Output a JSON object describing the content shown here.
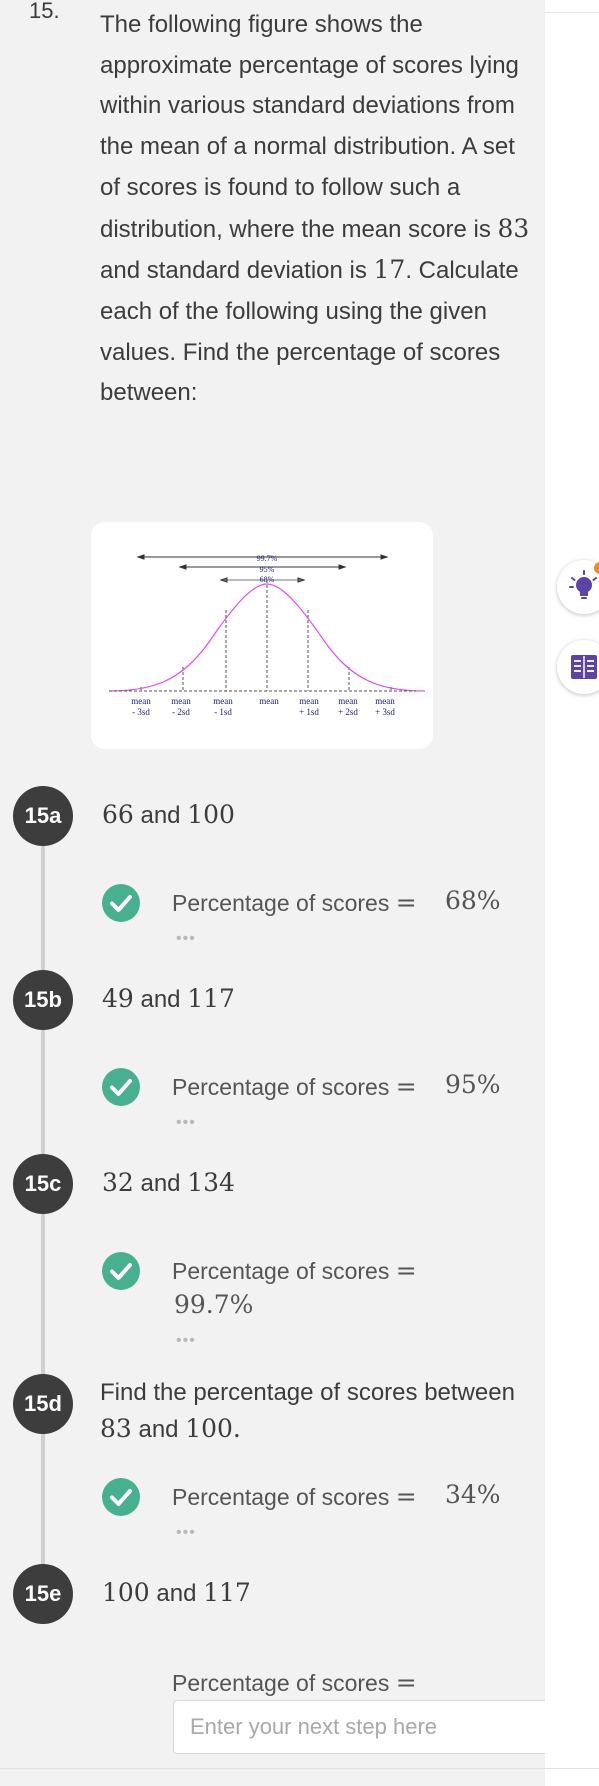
{
  "problem": {
    "number": "15.",
    "text_parts": [
      "The following figure shows the approximate percentage of scores lying within various standard deviations from the mean of a normal distribution. A set of scores is found to follow such a distribution, where the mean score is ",
      "83",
      " and standard deviation is ",
      "17",
      ". Calculate each of the following using the given values. Find the percentage of scores between:"
    ]
  },
  "figure": {
    "bands": [
      "99.7%",
      "95%",
      "68%"
    ],
    "axis_labels": [
      {
        "top": "mean",
        "bottom": "- 3sd"
      },
      {
        "top": "mean",
        "bottom": "- 2sd"
      },
      {
        "top": "mean",
        "bottom": "- 1sd"
      },
      {
        "top": "mean",
        "bottom": ""
      },
      {
        "top": "mean",
        "bottom": "+ 1sd"
      },
      {
        "top": "mean",
        "bottom": "+ 2sd"
      },
      {
        "top": "mean",
        "bottom": "+ 3sd"
      }
    ]
  },
  "steps": [
    {
      "id": "15a",
      "a": "66",
      "conj": "and",
      "b": "100",
      "answer_label": "Percentage of scores",
      "answer_eq": "=",
      "answer_value": "68%"
    },
    {
      "id": "15b",
      "a": "49",
      "conj": "and",
      "b": "117",
      "answer_label": "Percentage of scores",
      "answer_eq": "=",
      "answer_value": "95%"
    },
    {
      "id": "15c",
      "a": "32",
      "conj": "and",
      "b": "134",
      "answer_label": "Percentage of scores",
      "answer_eq": "=",
      "answer_value": "99.7%"
    },
    {
      "id": "15d",
      "text_start": "Find the percentage of scores between ",
      "a": "83",
      "conj": " and ",
      "b": "100",
      "end": ".",
      "answer_label": "Percentage of scores",
      "answer_eq": "=",
      "answer_value": "34%"
    },
    {
      "id": "15e",
      "a": "100",
      "conj": "and",
      "b": "117",
      "answer_label": "Percentage of scores",
      "answer_eq": "=",
      "input_placeholder": "Enter your next step here"
    }
  ],
  "dots": "•••",
  "colors": {
    "check_green": "#46b08f",
    "badge_dark": "#3d3d3d",
    "curve_magenta": "#e44de4",
    "hint_orange": "#f28b26",
    "icon_purple": "#5b43a8"
  },
  "rail": {
    "icons": [
      "lightbulb-hint-icon",
      "book-glossary-icon"
    ]
  }
}
